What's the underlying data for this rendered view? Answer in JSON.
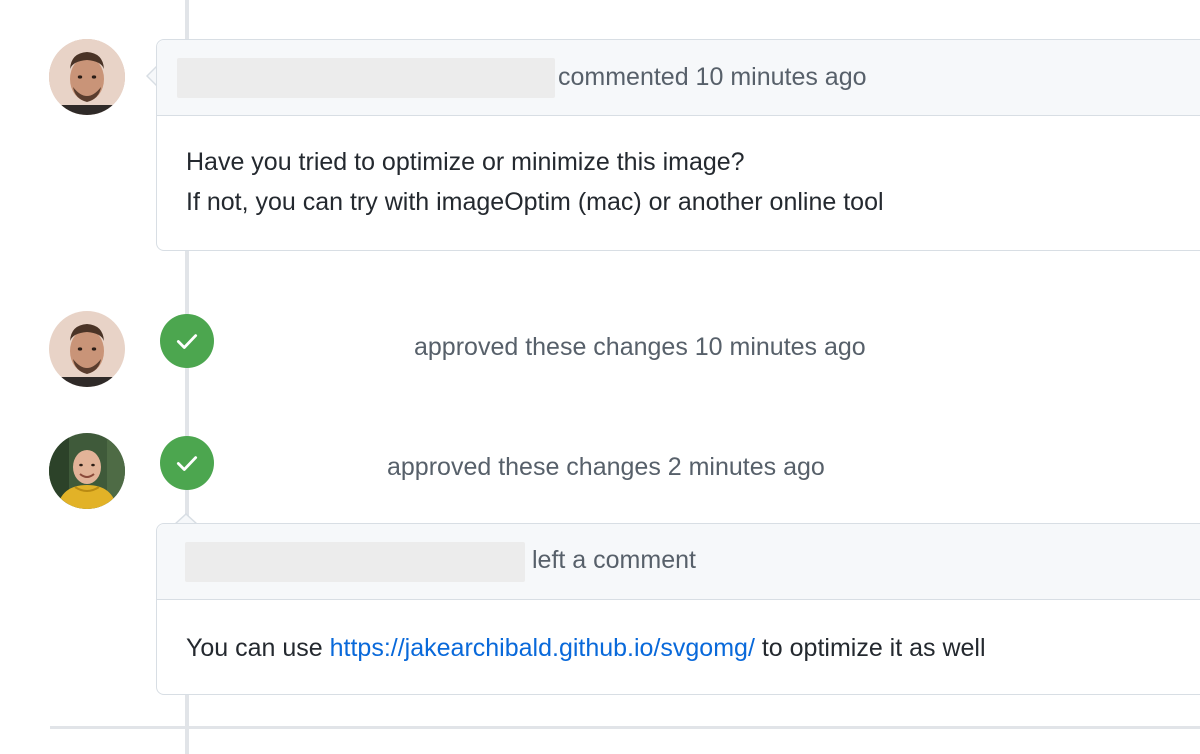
{
  "timeline": {
    "comment1": {
      "header_action": "commented 10 minutes ago",
      "body_lines": [
        "Have you tried to optimize or minimize this image?",
        "If not, you can try with imageOptim (mac) or another online tool"
      ]
    },
    "event1": {
      "text": "approved these changes 10 minutes ago",
      "icon": "check-icon"
    },
    "event2": {
      "text": "approved these changes 2 minutes ago",
      "icon": "check-icon"
    },
    "comment2": {
      "header_action": "left a comment",
      "body_before": "You can use ",
      "link_text": "https://jakearchibald.github.io/svgomg/",
      "body_after": " to optimize it as well"
    }
  },
  "colors": {
    "approve_green": "#4ca64f",
    "link_blue": "#0969da",
    "header_bg": "#f6f8fa",
    "border": "#d8dee4"
  }
}
